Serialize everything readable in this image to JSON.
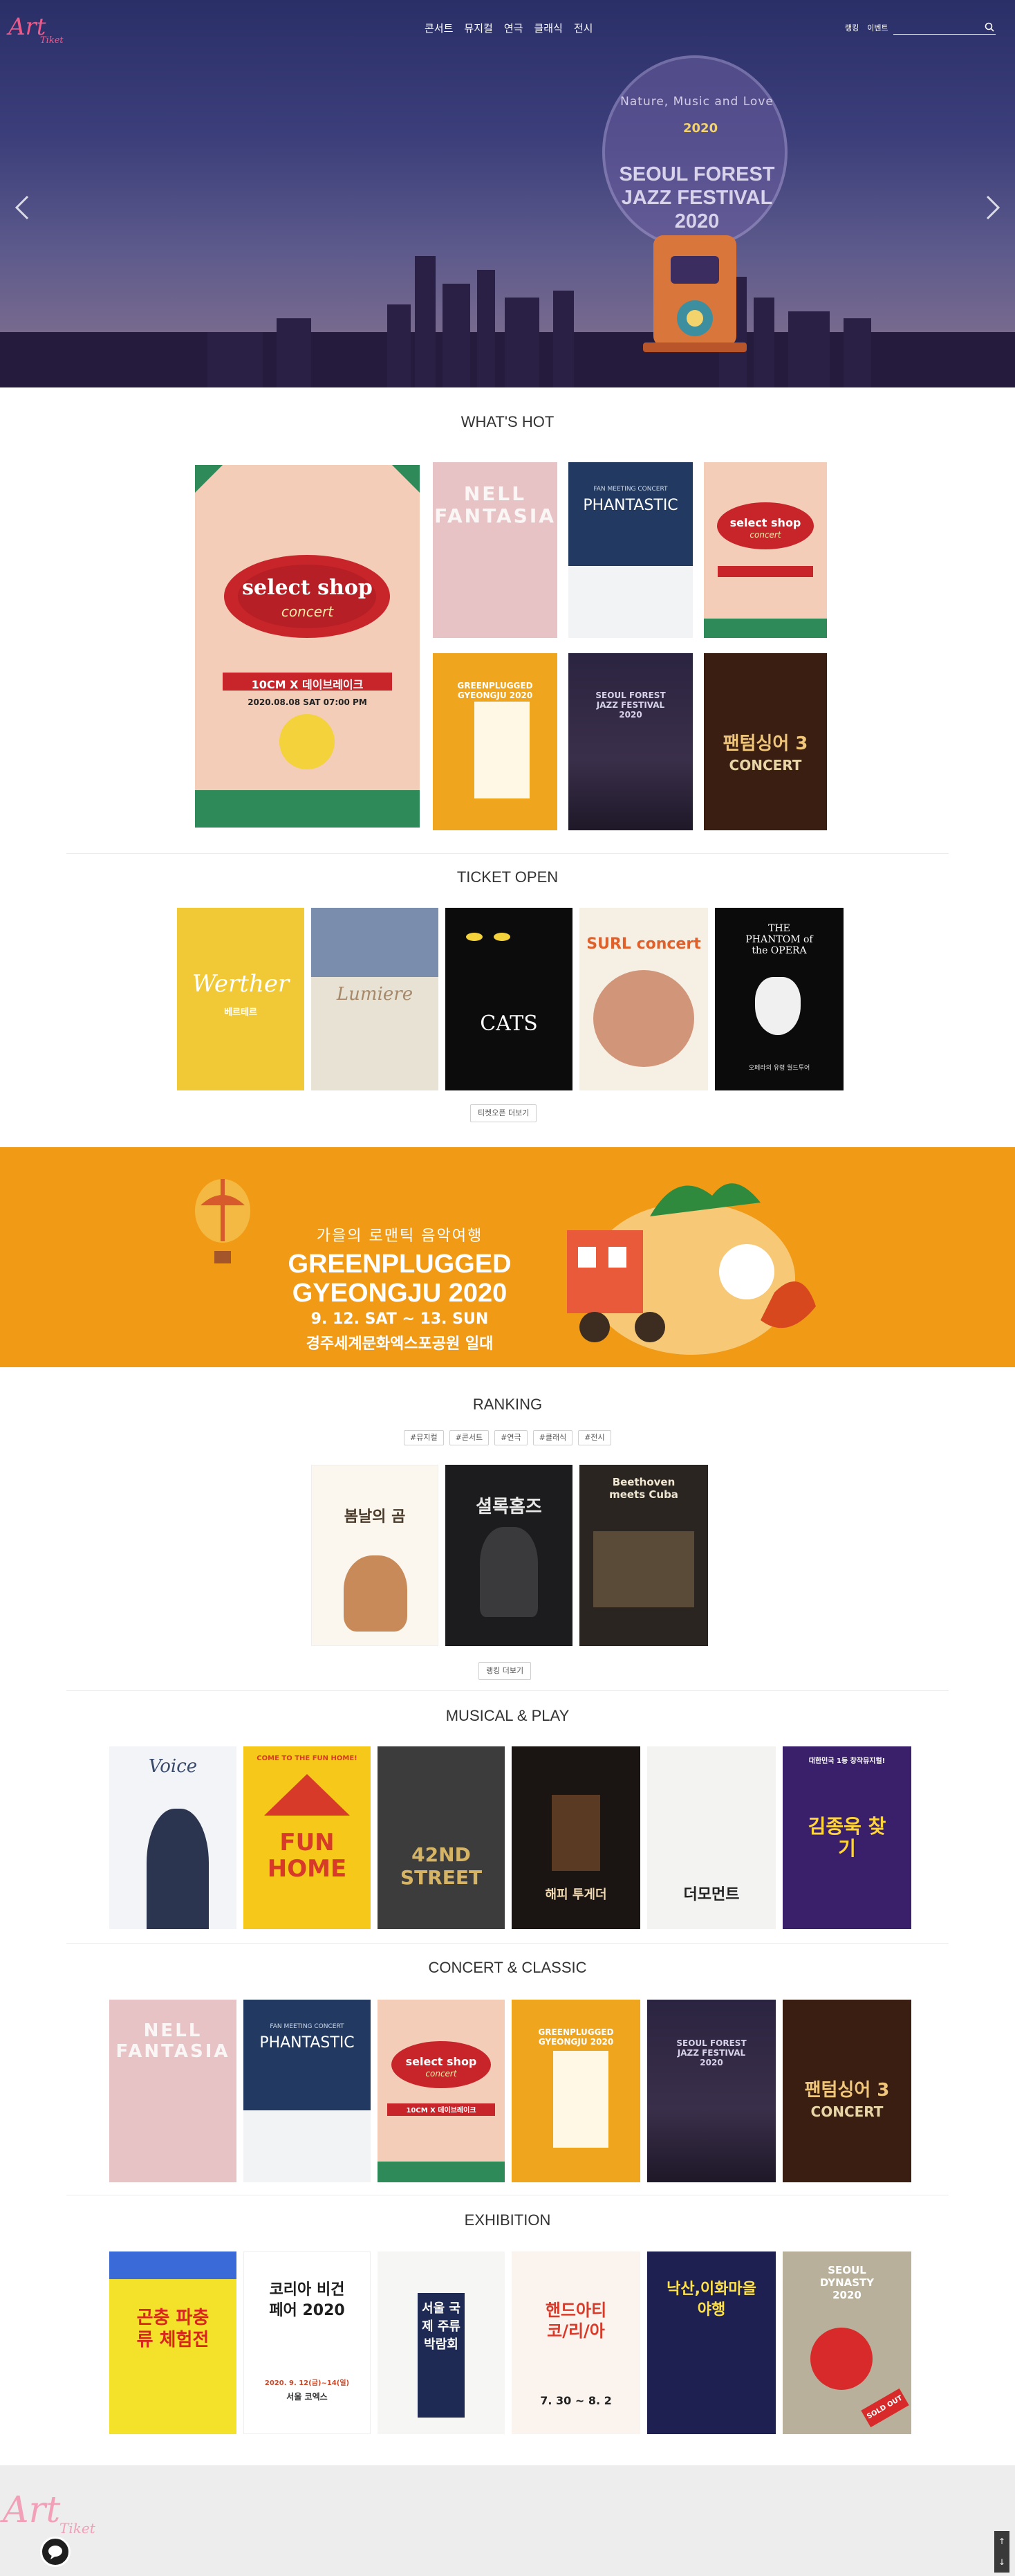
{
  "header": {
    "logo_text": "Art Tiket",
    "nav": [
      "콘서트",
      "뮤지컬",
      "연극",
      "클래식",
      "전시"
    ],
    "util": [
      "랭킹",
      "이벤트"
    ],
    "search_placeholder": ""
  },
  "hero": {
    "subtitle": "Nature, Music and Love",
    "year": "2020",
    "title_lines": [
      "SEOUL FOREST",
      "JAZZ FESTIVAL",
      "2020"
    ]
  },
  "sections": {
    "whats_hot": "WHAT'S HOT",
    "ticket_open": "TICKET OPEN",
    "ticket_open_more": "티켓오픈 더보기",
    "ranking": "RANKING",
    "ranking_tags": [
      "#뮤지컬",
      "#콘서트",
      "#연극",
      "#클래식",
      "#전시"
    ],
    "ranking_more": "랭킹 더보기",
    "musical_play": "MUSICAL & PLAY",
    "concert_classic": "CONCERT & CLASSIC",
    "exhibition": "EXHIBITION"
  },
  "banner": {
    "line1": "가을의 로맨틱 음악여행",
    "line2a": "GREENPLUGGED",
    "line2b": "GYEONGJU 2020",
    "line3": "9. 12. SAT ~ 13. SUN",
    "line4": "경주세계문화엑스포공원 일대"
  },
  "posters": {
    "hot_main": {
      "title": "select shop",
      "sub": "concert",
      "tag": "10CM X 데이브레이크",
      "date": "2020.08.08 SAT 07:00 PM"
    },
    "hot1": {
      "title": "NELL FANTASIA"
    },
    "hot2": {
      "title": "PHANTASTIC",
      "sub": "FAN MEETING CONCERT"
    },
    "hot3": {
      "title": "select shop",
      "sub": "concert"
    },
    "hot4": {
      "title": "GREENPLUGGED GYEONGJU 2020"
    },
    "hot5": {
      "title": "SEOUL FOREST JAZZ FESTIVAL 2020"
    },
    "hot6": {
      "title": "팬텀싱어 3",
      "sub": "CONCERT"
    },
    "open1": {
      "title": "Werther",
      "sub": "베르테르"
    },
    "open2": {
      "title": "Lumiere"
    },
    "open3": {
      "title": "CATS"
    },
    "open4": {
      "title": "SURL concert"
    },
    "open5": {
      "title": "THE PHANTOM of the OPERA",
      "sub": "오페라의 유령 월드투어"
    },
    "rank1": {
      "title": "봄날의 곰"
    },
    "rank2": {
      "title": "셜록홈즈"
    },
    "rank3": {
      "title": "Beethoven meets Cuba"
    },
    "mp1": {
      "title": "Voice"
    },
    "mp2": {
      "title": "FUN HOME",
      "sub": "COME TO THE FUN HOME!"
    },
    "mp3": {
      "title": "42ND STREET"
    },
    "mp4": {
      "title": "해피 투게더"
    },
    "mp5": {
      "title": "더모먼트"
    },
    "mp6": {
      "title": "김종욱 찾기",
      "sub": "대한민국 1등 창작뮤지컬!"
    },
    "cc1": {
      "title": "NELL FANTASIA"
    },
    "cc2": {
      "title": "PHANTASTIC",
      "sub": "FAN MEETING CONCERT"
    },
    "cc3": {
      "title": "select shop",
      "sub": "concert",
      "tag": "10CM X 데이브레이크"
    },
    "cc4": {
      "title": "GREENPLUGGED GYEONGJU 2020"
    },
    "cc5": {
      "title": "SEOUL FOREST JAZZ FESTIVAL 2020"
    },
    "cc6": {
      "title": "팬텀싱어 3",
      "sub": "CONCERT"
    },
    "ex1": {
      "title": "곤충 파충류 체험전"
    },
    "ex2": {
      "title": "코리아 비건 페어 2020",
      "sub": "2020. 9. 12(금)~14(일)",
      "place": "서울 코엑스"
    },
    "ex3": {
      "title": "서울 국제 주류 박람회"
    },
    "ex4": {
      "title": "핸드아티 코/리/아",
      "date": "7. 30 ~ 8. 2"
    },
    "ex5": {
      "title": "낙산,이화마을 야행"
    },
    "ex6": {
      "title": "SEOUL DYNASTY 2020",
      "badge": "SOLD OUT"
    }
  },
  "footer": {
    "logo_text": "Art Tiket"
  },
  "colors": {
    "accent": "#e0437a",
    "banner": "#f19a16",
    "hero": "#2b2f68"
  }
}
